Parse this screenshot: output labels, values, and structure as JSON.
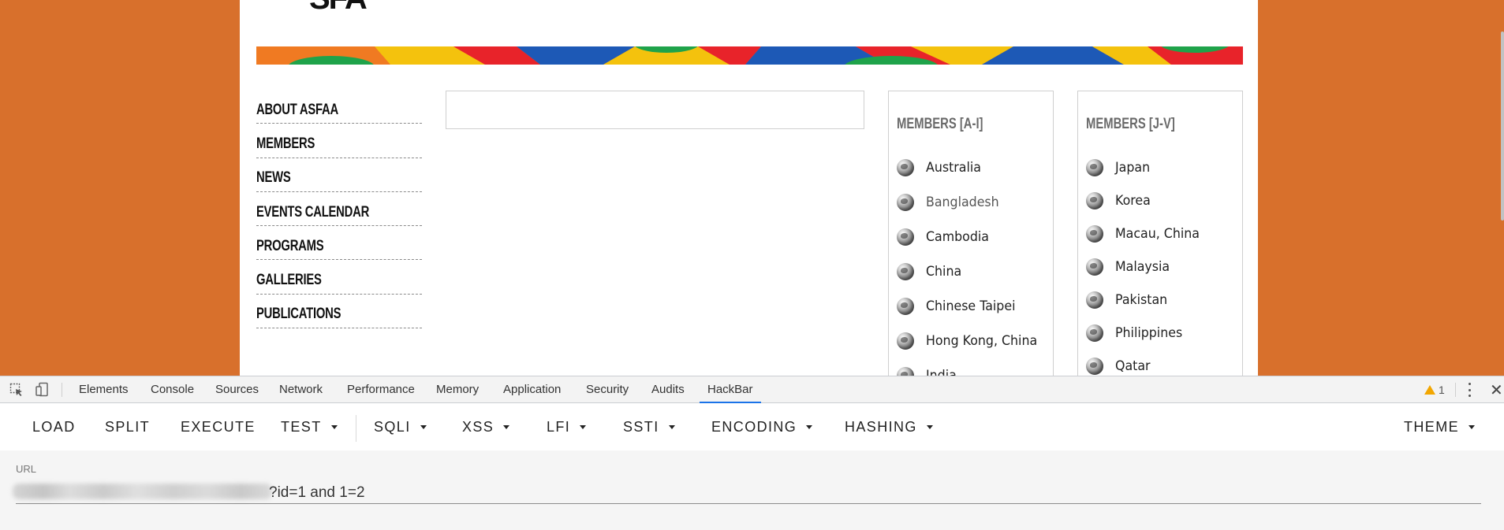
{
  "site": {
    "logo_fragment": "SFA",
    "nav": [
      "ABOUT ASFAA",
      "MEMBERS",
      "NEWS",
      "EVENTS CALENDAR",
      "PROGRAMS",
      "GALLERIES",
      "PUBLICATIONS"
    ],
    "members_a": {
      "title": "MEMBERS [A-I]",
      "countries": [
        "Australia",
        "Bangladesh",
        "Cambodia",
        "China",
        "Chinese Taipei",
        "Hong Kong, China",
        "India"
      ]
    },
    "members_b": {
      "title": "MEMBERS [J-V]",
      "countries": [
        "Japan",
        "Korea",
        "Macau, China",
        "Malaysia",
        "Pakistan",
        "Philippines",
        "Qatar"
      ]
    },
    "background_color": "#d8702c"
  },
  "devtools": {
    "tabs": [
      "Elements",
      "Console",
      "Sources",
      "Network",
      "Performance",
      "Memory",
      "Application",
      "Security",
      "Audits",
      "HackBar"
    ],
    "active_tab": "HackBar",
    "warning_count": "1",
    "icons": [
      "inspect-icon",
      "device-toolbar-icon",
      "warning-icon",
      "kebab-menu-icon",
      "close-icon"
    ]
  },
  "hackbar": {
    "buttons": [
      {
        "label": "LOAD",
        "dropdown": false
      },
      {
        "label": "SPLIT",
        "dropdown": false
      },
      {
        "label": "EXECUTE",
        "dropdown": false
      },
      {
        "label": "TEST",
        "dropdown": true
      },
      {
        "label": "SQLI",
        "dropdown": true
      },
      {
        "label": "XSS",
        "dropdown": true
      },
      {
        "label": "LFI",
        "dropdown": true
      },
      {
        "label": "SSTI",
        "dropdown": true
      },
      {
        "label": "ENCODING",
        "dropdown": true
      },
      {
        "label": "HASHING",
        "dropdown": true
      },
      {
        "label": "THEME",
        "dropdown": true
      }
    ],
    "url_label": "URL",
    "url_value_visible": "?id=1 and 1=2"
  }
}
